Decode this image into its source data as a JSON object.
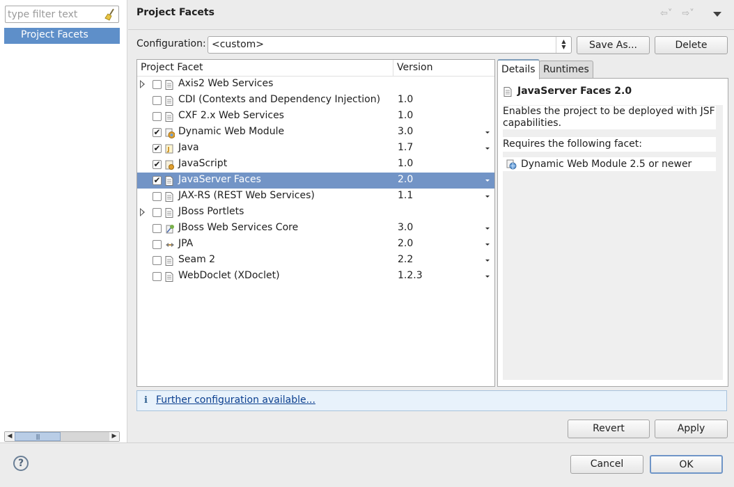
{
  "sidebar": {
    "filter_placeholder": "type filter text",
    "items": [
      {
        "label": "Project Facets",
        "selected": true
      }
    ]
  },
  "header": {
    "title": "Project Facets",
    "back_arrow": "⇦˅",
    "forward_arrow": "⇨˅"
  },
  "configuration": {
    "label": "Configuration:",
    "value": "<custom>",
    "save_as_label": "Save As...",
    "delete_label": "Delete"
  },
  "facets_table": {
    "col_facet": "Project Facet",
    "col_version": "Version",
    "rows": [
      {
        "name": "Axis2 Web Services",
        "version": "",
        "checked": false,
        "expandable": true,
        "has_dropdown": false,
        "icon": "page-icon"
      },
      {
        "name": "CDI (Contexts and Dependency Injection)",
        "version": "1.0",
        "checked": false,
        "expandable": false,
        "has_dropdown": false,
        "icon": "page-icon"
      },
      {
        "name": "CXF 2.x Web Services",
        "version": "1.0",
        "checked": false,
        "expandable": false,
        "has_dropdown": false,
        "icon": "page-icon"
      },
      {
        "name": "Dynamic Web Module",
        "version": "3.0",
        "checked": true,
        "expandable": false,
        "has_dropdown": true,
        "icon": "web-module-icon"
      },
      {
        "name": "Java",
        "version": "1.7",
        "checked": true,
        "expandable": false,
        "has_dropdown": true,
        "icon": "java-icon"
      },
      {
        "name": "JavaScript",
        "version": "1.0",
        "checked": true,
        "expandable": false,
        "has_dropdown": false,
        "icon": "javascript-icon"
      },
      {
        "name": "JavaServer Faces",
        "version": "2.0",
        "checked": true,
        "expandable": false,
        "has_dropdown": true,
        "icon": "page-icon",
        "selected": true
      },
      {
        "name": "JAX-RS (REST Web Services)",
        "version": "1.1",
        "checked": false,
        "expandable": false,
        "has_dropdown": true,
        "icon": "page-icon"
      },
      {
        "name": "JBoss Portlets",
        "version": "",
        "checked": false,
        "expandable": true,
        "has_dropdown": false,
        "icon": "page-icon"
      },
      {
        "name": "JBoss Web Services Core",
        "version": "3.0",
        "checked": false,
        "expandable": false,
        "has_dropdown": true,
        "icon": "web-services-icon"
      },
      {
        "name": "JPA",
        "version": "2.0",
        "checked": false,
        "expandable": false,
        "has_dropdown": true,
        "icon": "jpa-icon"
      },
      {
        "name": "Seam 2",
        "version": "2.2",
        "checked": false,
        "expandable": false,
        "has_dropdown": true,
        "icon": "page-icon"
      },
      {
        "name": "WebDoclet (XDoclet)",
        "version": "1.2.3",
        "checked": false,
        "expandable": false,
        "has_dropdown": true,
        "icon": "page-icon"
      }
    ]
  },
  "details": {
    "tab_details": "Details",
    "tab_runtimes": "Runtimes",
    "title": "JavaServer Faces 2.0",
    "description": "Enables the project to be deployed with JSF capabilities.",
    "requires_label": "Requires the following facet:",
    "requirement": "Dynamic Web Module 2.5 or newer"
  },
  "info_bar": {
    "icon": "i",
    "link_text": "Further configuration available..."
  },
  "actions": {
    "revert_label": "Revert",
    "apply_label": "Apply",
    "cancel_label": "Cancel",
    "ok_label": "OK",
    "help_label": "?"
  },
  "colors": {
    "selection": "#7294c6",
    "nav_selection": "#5e8fc9",
    "info_background": "#e8f2fb"
  }
}
